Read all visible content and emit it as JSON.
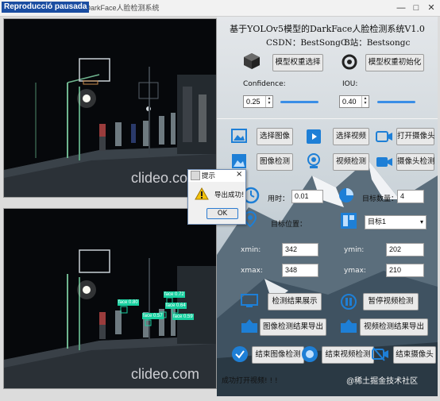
{
  "window": {
    "title": "基于YOLOv5模型的DarkFace人脸检测系统",
    "reproduction_badge": "Reproducció pausada",
    "controls": [
      "—",
      "□",
      "✕"
    ]
  },
  "video_panels": {
    "watermark": "clideo.com",
    "detections": [
      {
        "label": "face 0.80"
      },
      {
        "label": "face 0.57"
      },
      {
        "label": "face 0.72"
      },
      {
        "label": "face 0.64"
      },
      {
        "label": "face 0.59"
      }
    ]
  },
  "header": {
    "title": "基于YOLOv5模型的DarkFace人脸检测系统V1.0",
    "csdn": "CSDN：BestSongC",
    "bilibili": "B站：Bestsongc"
  },
  "weights": {
    "select_label": "模型权重选择",
    "init_label": "模型权重初始化"
  },
  "params": {
    "confidence_label": "Confidence:",
    "confidence_value": "0.25",
    "iou_label": "IOU:",
    "iou_value": "0.40"
  },
  "actions": {
    "select_image": "选择图像",
    "select_video": "选择视频",
    "open_camera": "打开摄像头",
    "image_detect": "图像检测",
    "video_detect": "视频检测",
    "camera_detect": "摄像头检测"
  },
  "stats": {
    "time_label": "用时：",
    "time_value": "0.01",
    "count_label": "目标数量：",
    "count_value": "4",
    "position_label": "目标位置：",
    "target_select": "目标1",
    "xmin_label": "xmin:",
    "xmin_value": "342",
    "ymin_label": "ymin:",
    "ymin_value": "202",
    "xmax_label": "xmax:",
    "xmax_value": "348",
    "ymax_label": "ymax:",
    "ymax_value": "210"
  },
  "controls": {
    "show_results": "检测结果展示",
    "pause_video": "暂停视频检测",
    "export_image": "图像检测结果导出",
    "export_video": "视频检测结果导出",
    "end_image": "结束图像检测",
    "end_video": "结束视频检测",
    "end_camera": "结束摄像头"
  },
  "dialog": {
    "title": "提示",
    "message": "导出成功!",
    "ok": "OK"
  },
  "status": {
    "text": "成功打开视频! ! !",
    "footer_watermark": "@稀土掘金技术社区"
  },
  "colors": {
    "accent": "#1e7fd6",
    "detection_box": "#19d0a0"
  }
}
